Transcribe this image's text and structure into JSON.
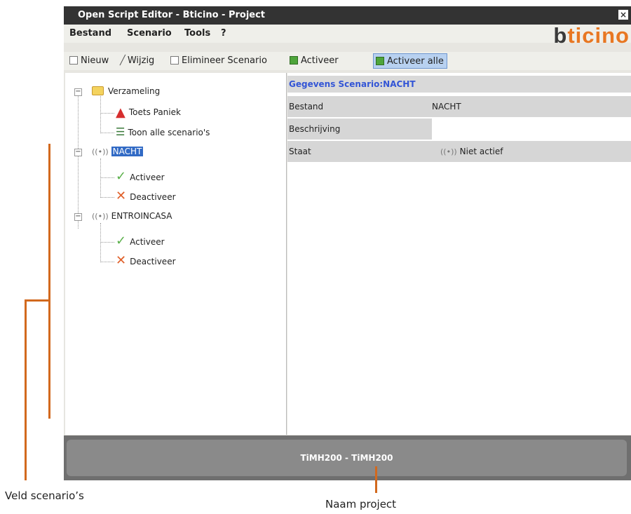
{
  "window": {
    "title": "Open Script Editor - Bticino - Project"
  },
  "logo": {
    "text_b": "b",
    "text_rest": "ticino"
  },
  "menu": [
    "Bestand",
    "Scenario",
    "Tools",
    "?"
  ],
  "toolbar": {
    "new": "Nieuw",
    "edit": "Wijzig",
    "delete": "Elimineer Scenario",
    "activate": "Activeer",
    "activate_all": "Activeer alle"
  },
  "tree": {
    "collection": "Verzameling",
    "panic": "Toets Paniek",
    "show_all": "Toon alle scenario's",
    "scenarios": [
      {
        "name": "NACHT",
        "activate": "Activeer",
        "deactivate": "Deactiveer"
      },
      {
        "name": "ENTROINCASA",
        "activate": "Activeer",
        "deactivate": "Deactiveer"
      }
    ]
  },
  "details": {
    "header": "Gegevens Scenario:NACHT",
    "rows": [
      {
        "key": "Bestand",
        "value": "NACHT"
      },
      {
        "key": "Beschrijving",
        "value": ""
      },
      {
        "key": "Staat",
        "value": "Niet actief"
      }
    ]
  },
  "status": {
    "project_name": "TiMH200 - TiMH200"
  },
  "annotations": {
    "scenario_field": "Veld scenario’s",
    "project_name": "Naam project"
  },
  "colors": {
    "annotation": "#d2691e",
    "logo": "#e87722",
    "selection": "#316ac5"
  }
}
